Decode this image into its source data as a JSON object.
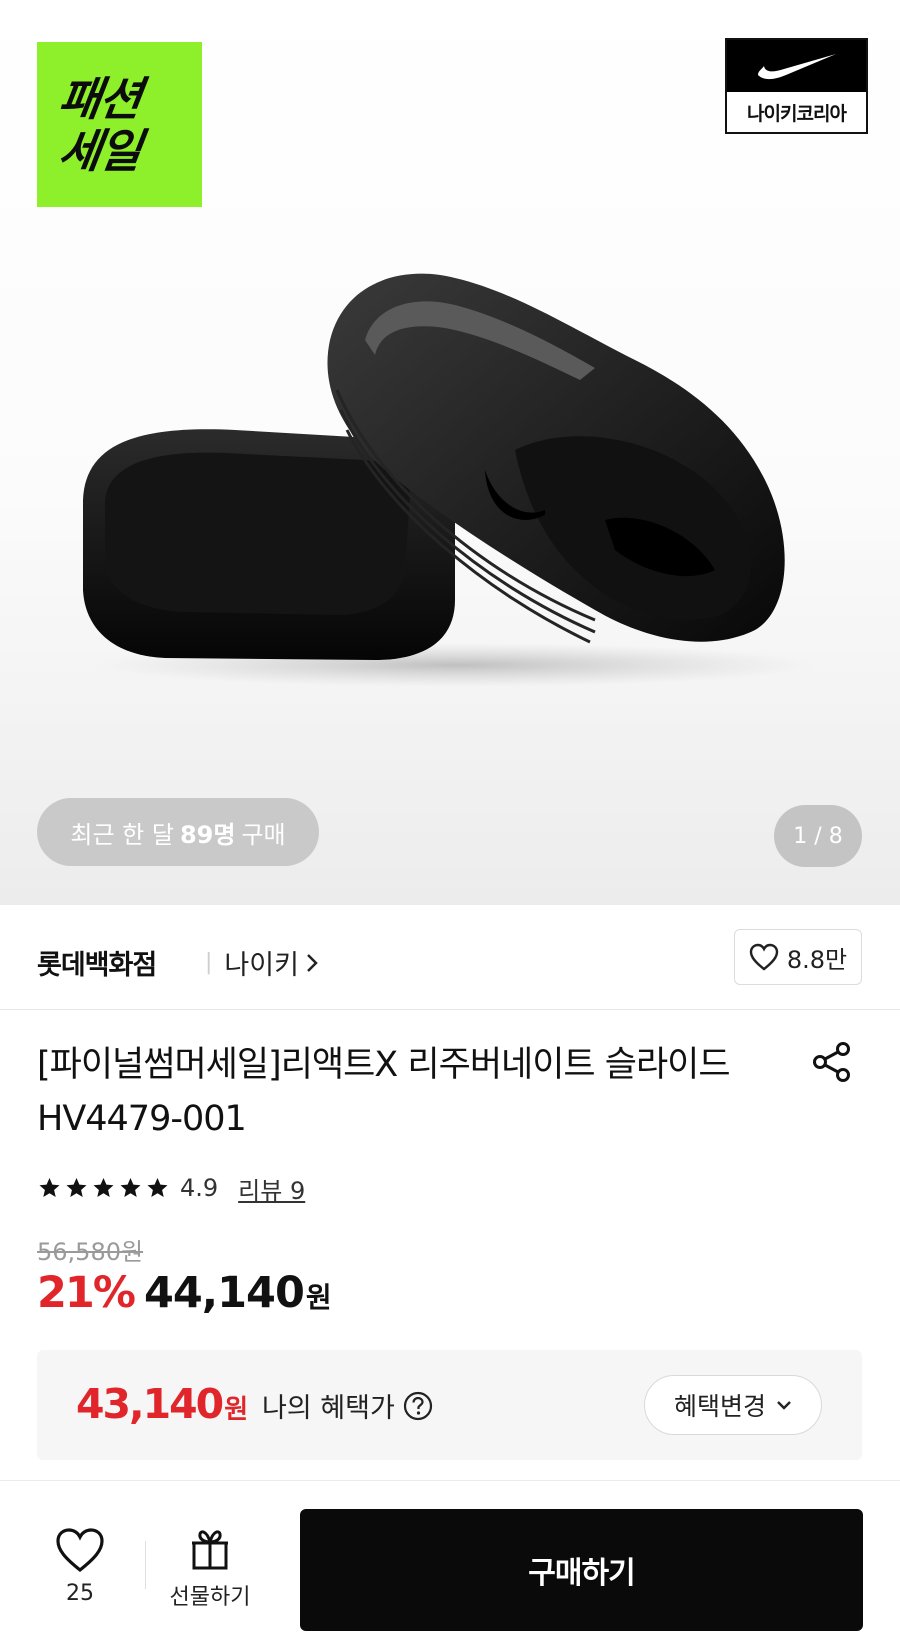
{
  "badge": {
    "line1": "패션",
    "line2": "세일"
  },
  "brand_logo": {
    "label": "나이키코리아",
    "icon": "nike-swoosh-icon"
  },
  "hero": {
    "recent_prefix": "최근 한 달",
    "recent_count": "89명",
    "recent_suffix": "구매",
    "image_counter": "1 / 8"
  },
  "store": {
    "name": "롯데백화점",
    "separator": "|",
    "brand": "나이키",
    "likes": "8.8만"
  },
  "product": {
    "title": "[파이널썸머세일]리액트X 리주버네이트 슬라이드 HV4479-001",
    "rating": "4.9",
    "review_link": "리뷰 9",
    "stars": 5,
    "original_price": "56,580원",
    "discount": "21%",
    "price": "44,140",
    "currency": "원"
  },
  "benefit": {
    "price": "43,140",
    "currency": "원",
    "label": "나의 혜택가",
    "button": "혜택변경"
  },
  "bottom_bar": {
    "wish_count": "25",
    "gift_label": "선물하기",
    "buy_label": "구매하기"
  },
  "colors": {
    "accent": "#e0262a",
    "badge_green": "#8ef02a",
    "button_black": "#0a0a0a"
  }
}
